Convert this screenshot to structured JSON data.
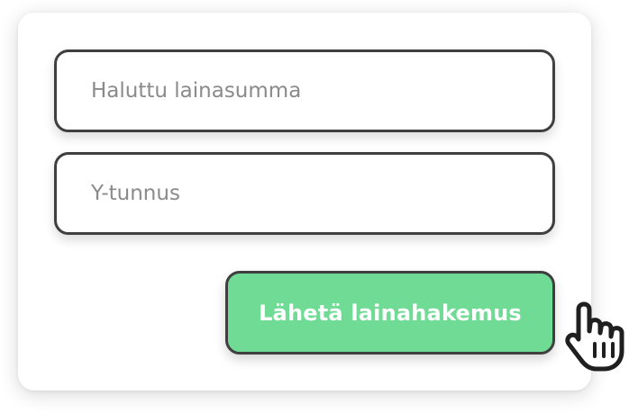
{
  "form": {
    "amount_placeholder": "Haluttu lainasumma",
    "ytunnus_placeholder": "Y-tunnus",
    "submit_label": "Lähetä lainahakemus"
  },
  "icons": {
    "pointer": "hand-pointer-icon"
  },
  "colors": {
    "submit_bg": "#6fdb94",
    "submit_text": "#ffffff",
    "border": "#3f3f3f",
    "placeholder": "#8a8a8a"
  }
}
